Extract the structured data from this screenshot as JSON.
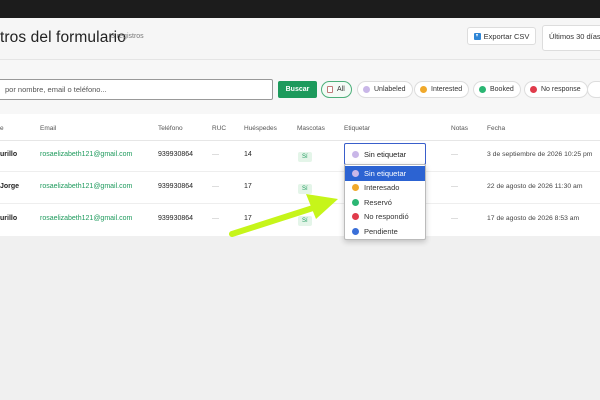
{
  "header": {
    "title": "tros del formulario",
    "count": "3 registros",
    "export_label": "Exportar CSV",
    "range_label": "Últimos 30 días"
  },
  "filters": {
    "search_placeholder": "por nombre, email o teléfono...",
    "search_button": "Buscar",
    "chips": [
      {
        "label": "All",
        "active": true
      },
      {
        "label": "Unlabeled",
        "color": "#c9b7e8"
      },
      {
        "label": "Interested",
        "color": "#f0a92b"
      },
      {
        "label": "Booked",
        "color": "#2bb673"
      },
      {
        "label": "No response",
        "color": "#e03b4b"
      }
    ]
  },
  "table": {
    "columns": [
      "e",
      "Email",
      "Teléfono",
      "RUC",
      "Huéspedes",
      "Mascotas",
      "Etiquetar",
      "Notas",
      "Fecha"
    ],
    "rows": [
      {
        "name": "urillo",
        "email": "rosaelizabeth121@gmail.com",
        "phone": "939930864",
        "ruc": "—",
        "guests": "14",
        "pets": "Sí",
        "notes": "—",
        "date": "3 de septiembre de 2026 10:25 pm"
      },
      {
        "name": "Jorge",
        "email": "rosaelizabeth121@gmail.com",
        "phone": "939930864",
        "ruc": "—",
        "guests": "17",
        "pets": "Sí",
        "notes": "—",
        "date": "22 de agosto de 2026 11:30 am"
      },
      {
        "name": "urillo",
        "email": "rosaelizabeth121@gmail.com",
        "phone": "939930864",
        "ruc": "—",
        "guests": "17",
        "pets": "Sí",
        "notes": "—",
        "date": "17 de agosto de 2026 8:53 am"
      }
    ]
  },
  "tag_select": {
    "current": "Sin etiquetar",
    "options": [
      {
        "label": "Sin etiquetar",
        "color": "#c9b7e8",
        "selected": true
      },
      {
        "label": "Interesado",
        "color": "#f0a92b"
      },
      {
        "label": "Reservó",
        "color": "#2bb673"
      },
      {
        "label": "No respondió",
        "color": "#e03b4b"
      },
      {
        "label": "Pendiente",
        "color": "#3a6fd8"
      }
    ]
  },
  "annotation": {
    "arrow_color": "#c6f51a"
  }
}
